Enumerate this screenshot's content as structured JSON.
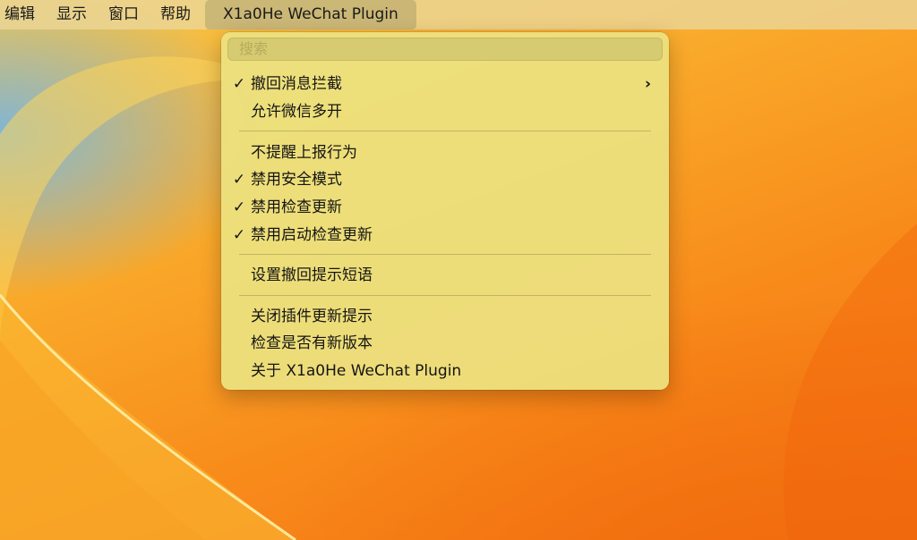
{
  "menubar": {
    "items": [
      "编辑",
      "显示",
      "窗口",
      "帮助"
    ],
    "active_label": "X1a0He WeChat Plugin"
  },
  "menu": {
    "search_placeholder": "搜索",
    "groups": [
      [
        {
          "label": "撤回消息拦截",
          "checked": true,
          "submenu": true
        },
        {
          "label": "允许微信多开",
          "checked": false,
          "submenu": false
        }
      ],
      [
        {
          "label": "不提醒上报行为",
          "checked": false
        },
        {
          "label": "禁用安全模式",
          "checked": true
        },
        {
          "label": "禁用检查更新",
          "checked": true
        },
        {
          "label": "禁用启动检查更新",
          "checked": true
        }
      ],
      [
        {
          "label": "设置撤回提示短语",
          "checked": false
        }
      ],
      [
        {
          "label": "关闭插件更新提示",
          "checked": false
        },
        {
          "label": "检查是否有新版本",
          "checked": false
        },
        {
          "label": "关于 X1a0He WeChat Plugin",
          "checked": false
        }
      ]
    ],
    "check_glyph": "✓",
    "chevron_glyph": "›"
  },
  "colors": {
    "menu_bg": "#ece280",
    "wallpaper_primary": "#f88a1a",
    "wallpaper_secondary": "#f7c84a"
  }
}
